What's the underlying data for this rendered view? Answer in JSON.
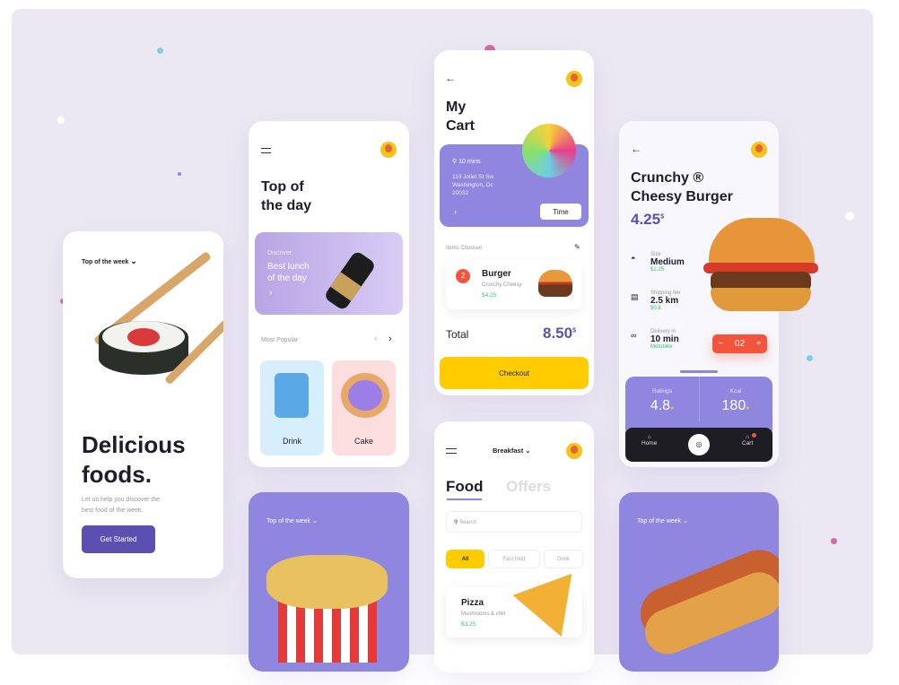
{
  "card_welcome": {
    "dropdown": "Top of the week",
    "headline_1": "Delicious",
    "headline_2": "foods.",
    "subtitle_1": "Let us help you discover the",
    "subtitle_2": "best food of the week.",
    "cta": "Get Started"
  },
  "card_top_day": {
    "title_1": "Top of",
    "title_2": "the day",
    "banner_kicker": "Discover",
    "banner_title_1": "Best lunch",
    "banner_title_2": "of the day",
    "section": "Most Popular",
    "items": [
      {
        "label": "Drink"
      },
      {
        "label": "Cake"
      }
    ]
  },
  "card_popcorn": {
    "dropdown": "Top of the week"
  },
  "card_cart": {
    "title_1": "My",
    "title_2": "Cart",
    "delivery_time": "10 mins",
    "address_1": "119 Joliet St Sw",
    "address_2": "Washington, Dc",
    "address_3": "20032",
    "time_button": "Time",
    "items_label": "Items Choosen",
    "item": {
      "qty": "2",
      "name": "Burger",
      "desc": "Crunchy Cheesy",
      "price": "$4.25"
    },
    "total_label": "Total",
    "total_value": "8.50",
    "currency": "$",
    "checkout": "Checkout"
  },
  "card_food": {
    "dropdown": "Breakfast",
    "tabs": [
      "Food",
      "Offers"
    ],
    "search_placeholder": "Search",
    "chips": [
      "All",
      "Fast food",
      "Drink"
    ],
    "item": {
      "name": "Pizza",
      "desc": "Mushrooms & chill",
      "price": "$3.25"
    }
  },
  "card_burger": {
    "title_1": "Crunchy ®",
    "title_2": "Cheesy Burger",
    "price": "4.25",
    "currency": "$",
    "specs": [
      {
        "label": "Size",
        "value": "Medium",
        "sub": "$1.25"
      },
      {
        "label": "Shipping fee",
        "value": "2.5 km",
        "sub": "$0.8"
      },
      {
        "label": "Delivery in",
        "value": "10 min",
        "sub": "Motobike"
      }
    ],
    "quantity": "02",
    "ratings_label": "Ratings",
    "ratings": "4.8",
    "kcal_label": "Kcal",
    "kcal": "180",
    "nav": [
      "Home",
      "Cart"
    ]
  },
  "card_hotdog": {
    "dropdown": "Top of the week"
  },
  "colors": {
    "accent": "#8f86e0",
    "yellow": "#ffcc00",
    "green": "#3cc46b",
    "red": "#f2553c"
  }
}
